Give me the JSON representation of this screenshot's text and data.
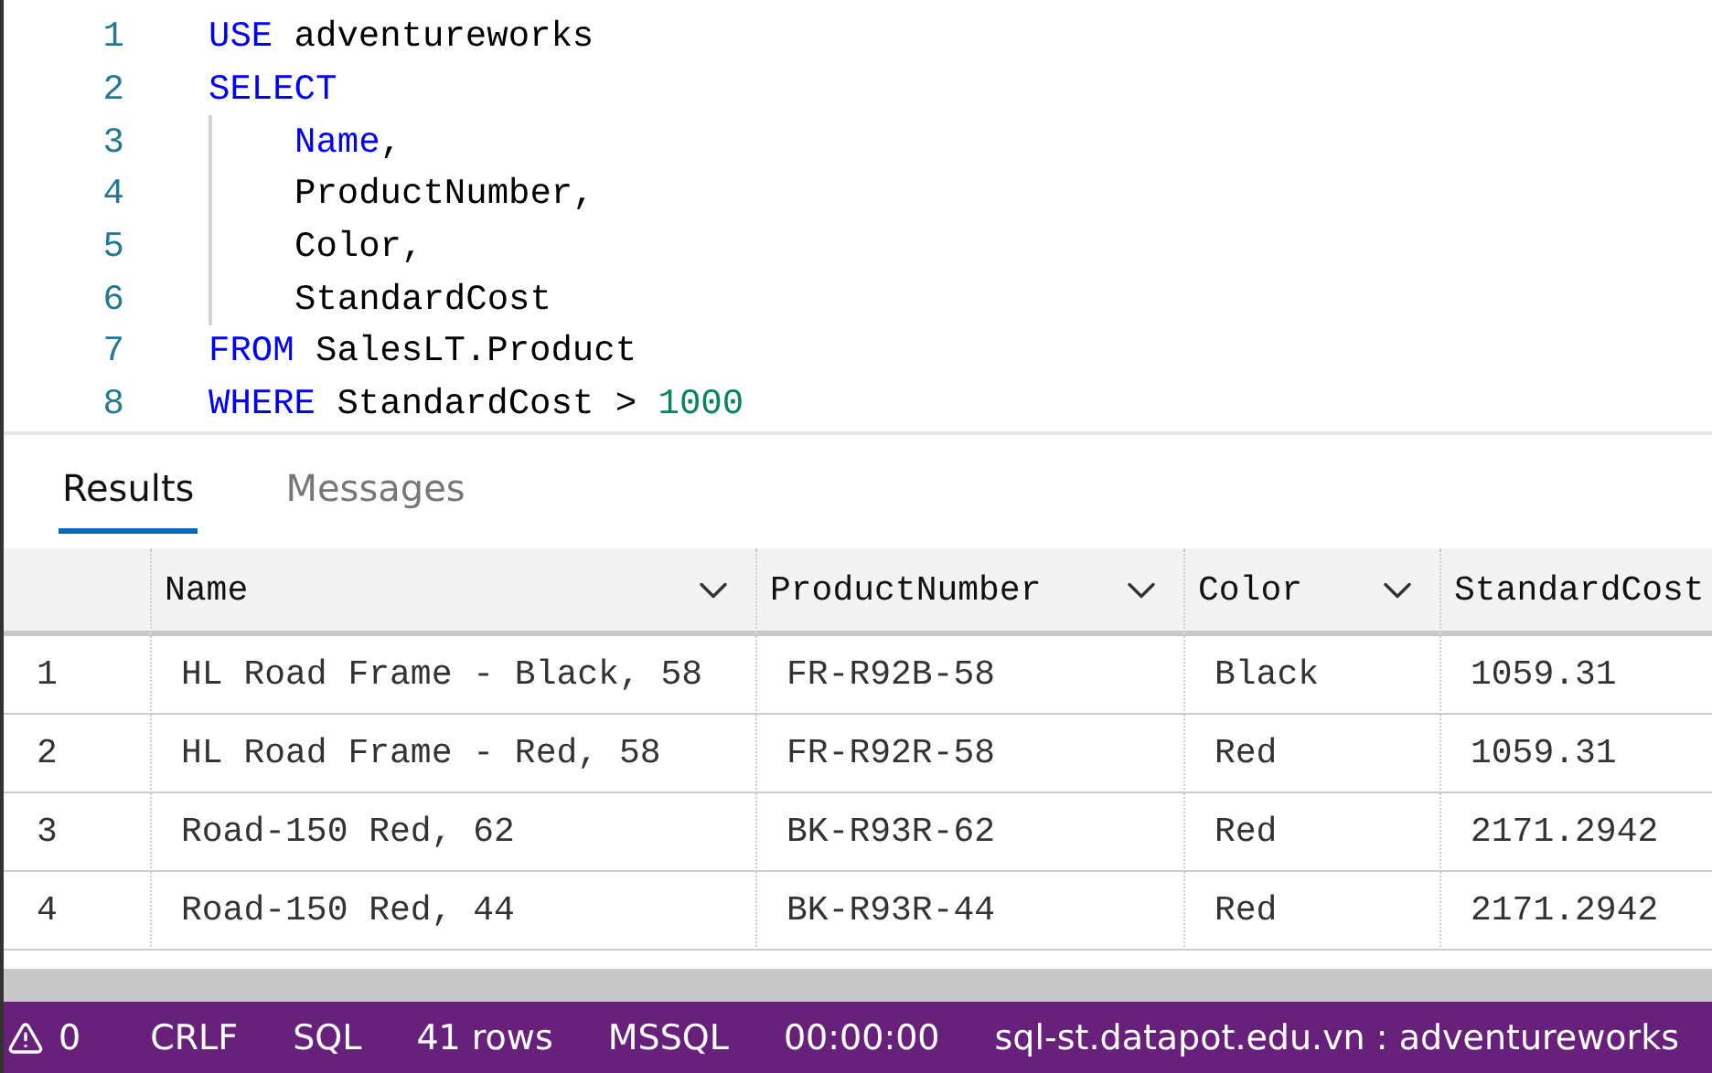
{
  "editor": {
    "lines": [
      {
        "number": "1",
        "indented": false,
        "tokens": [
          {
            "kind": "keyword",
            "text": "USE"
          },
          {
            "kind": "plain",
            "text": " adventureworks"
          }
        ]
      },
      {
        "number": "2",
        "indented": false,
        "tokens": [
          {
            "kind": "keyword",
            "text": "SELECT"
          }
        ]
      },
      {
        "number": "3",
        "indented": true,
        "tokens": [
          {
            "kind": "keyword",
            "text": "Name"
          },
          {
            "kind": "plain",
            "text": ","
          }
        ]
      },
      {
        "number": "4",
        "indented": true,
        "tokens": [
          {
            "kind": "plain",
            "text": "ProductNumber,"
          }
        ]
      },
      {
        "number": "5",
        "indented": true,
        "tokens": [
          {
            "kind": "plain",
            "text": "Color,"
          }
        ]
      },
      {
        "number": "6",
        "indented": true,
        "tokens": [
          {
            "kind": "plain",
            "text": "StandardCost"
          }
        ]
      },
      {
        "number": "7",
        "indented": false,
        "tokens": [
          {
            "kind": "keyword",
            "text": "FROM"
          },
          {
            "kind": "plain",
            "text": " SalesLT.Product"
          }
        ]
      },
      {
        "number": "8",
        "indented": false,
        "tokens": [
          {
            "kind": "keyword",
            "text": "WHERE"
          },
          {
            "kind": "plain",
            "text": " StandardCost > "
          },
          {
            "kind": "number",
            "text": "1000"
          }
        ]
      }
    ]
  },
  "tabs": [
    {
      "label": "Results",
      "selected": true
    },
    {
      "label": "Messages",
      "selected": false
    }
  ],
  "table": {
    "columns": [
      "Name",
      "ProductNumber",
      "Color",
      "StandardCost"
    ],
    "rows": [
      {
        "index": "1",
        "cells": [
          "HL Road Frame - Black, 58",
          "FR-R92B-58",
          "Black",
          "1059.31"
        ]
      },
      {
        "index": "2",
        "cells": [
          "HL Road Frame - Red, 58",
          "FR-R92R-58",
          "Red",
          "1059.31"
        ]
      },
      {
        "index": "3",
        "cells": [
          "Road-150 Red, 62",
          "BK-R93R-62",
          "Red",
          "2171.2942"
        ]
      },
      {
        "index": "4",
        "cells": [
          "Road-150 Red, 44",
          "BK-R93R-44",
          "Red",
          "2171.2942"
        ]
      }
    ]
  },
  "status_bar": {
    "warnings": "0",
    "items": [
      "CRLF",
      "SQL",
      "41 rows",
      "MSSQL",
      "00:00:00",
      "sql-st.datapot.edu.vn : adventureworks"
    ]
  }
}
